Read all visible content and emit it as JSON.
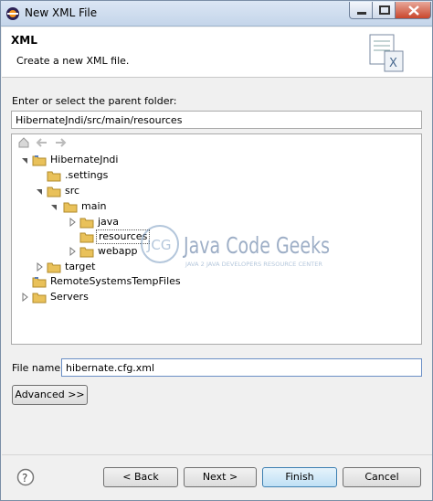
{
  "window": {
    "title": "New XML File"
  },
  "header": {
    "title": "XML",
    "description": "Create a new XML file."
  },
  "parent_folder": {
    "label": "Enter or select the parent folder:",
    "value": "HibernateJndi/src/main/resources"
  },
  "tree": {
    "items": [
      {
        "label": "HibernateJndi",
        "icon": "project-icon",
        "expanded": true
      },
      {
        "label": ".settings",
        "icon": "folder-icon"
      },
      {
        "label": "src",
        "icon": "folder-icon",
        "expanded": true
      },
      {
        "label": "main",
        "icon": "folder-icon",
        "expanded": true
      },
      {
        "label": "java",
        "icon": "folder-icon",
        "expanded": false
      },
      {
        "label": "resources",
        "icon": "folder-icon",
        "selected": true
      },
      {
        "label": "webapp",
        "icon": "folder-icon",
        "expanded": false
      },
      {
        "label": "target",
        "icon": "folder-icon",
        "expanded": false
      },
      {
        "label": "RemoteSystemsTempFiles",
        "icon": "project-icon"
      },
      {
        "label": "Servers",
        "icon": "folder-icon",
        "expanded": false
      }
    ]
  },
  "watermark": {
    "brand": "Java Code Geeks",
    "tagline": "JAVA 2 JAVA DEVELOPERS RESOURCE CENTER",
    "logo": "JCG"
  },
  "file_name": {
    "label": "File name:",
    "value": "hibernate.cfg.xml"
  },
  "buttons": {
    "advanced": "Advanced >>",
    "back": "< Back",
    "next": "Next >",
    "finish": "Finish",
    "cancel": "Cancel"
  },
  "colors": {
    "accent": "#3c7fb1",
    "folder": "#e9c15a",
    "selection_border": "#555555"
  }
}
